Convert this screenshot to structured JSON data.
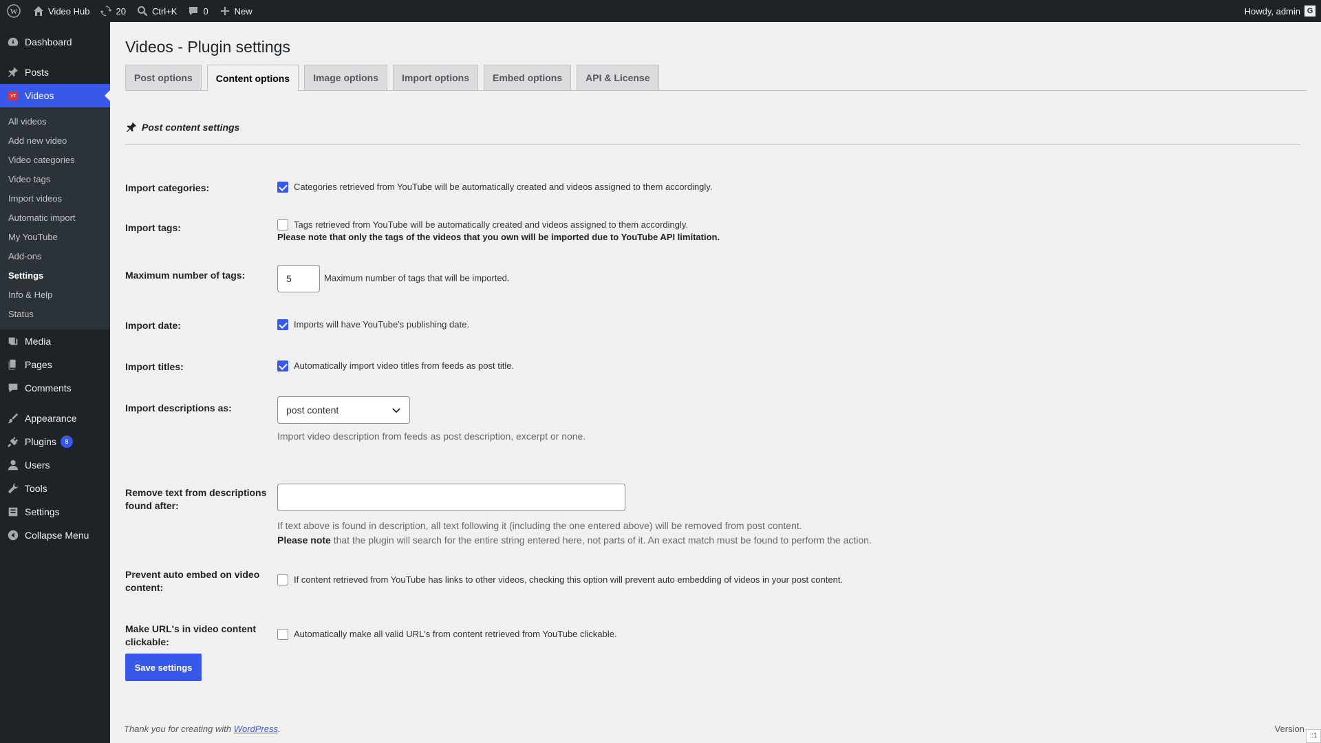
{
  "adminbar": {
    "site_name": "Video Hub",
    "updates_count": "20",
    "search_shortcut": "Ctrl+K",
    "comments_count": "0",
    "new_label": "New",
    "howdy": "Howdy, admin",
    "avatar_letter": "G"
  },
  "sidebar": {
    "dashboard": "Dashboard",
    "posts": "Posts",
    "videos": "Videos",
    "sub": [
      "All videos",
      "Add new video",
      "Video categories",
      "Video tags",
      "Import videos",
      "Automatic import",
      "My YouTube",
      "Add-ons",
      "Settings",
      "Info & Help",
      "Status"
    ],
    "media": "Media",
    "pages": "Pages",
    "comments": "Comments",
    "appearance": "Appearance",
    "plugins": "Plugins",
    "plugins_badge": "8",
    "users": "Users",
    "tools": "Tools",
    "settings": "Settings",
    "collapse": "Collapse Menu"
  },
  "page": {
    "title": "Videos - Plugin settings",
    "tabs": [
      "Post options",
      "Content options",
      "Image options",
      "Import options",
      "Embed options",
      "API & License"
    ],
    "section_title": "Post content settings"
  },
  "form": {
    "import_categories": {
      "label": "Import categories:",
      "desc": "Categories retrieved from YouTube will be automatically created and videos assigned to them accordingly.",
      "checked": true
    },
    "import_tags": {
      "label": "Import tags:",
      "desc": "Tags retrieved from YouTube will be automatically created and videos assigned to them accordingly.",
      "note": "Please note that only the tags of the videos that you own will be imported due to YouTube API limitation.",
      "checked": false
    },
    "max_tags": {
      "label": "Maximum number of tags:",
      "value": "5",
      "desc": "Maximum number of tags that will be imported."
    },
    "import_date": {
      "label": "Import date:",
      "desc": "Imports will have YouTube's publishing date.",
      "checked": true
    },
    "import_titles": {
      "label": "Import titles:",
      "desc": "Automatically import video titles from feeds as post title.",
      "checked": true
    },
    "import_descriptions": {
      "label": "Import descriptions as:",
      "selected": "post content",
      "desc": "Import video description from feeds as post description, excerpt or none."
    },
    "remove_text": {
      "label_line1": "Remove text from descriptions",
      "label_line2": "found after:",
      "value": "",
      "desc1": "If text above is found in description, all text following it (including the one entered above) will be removed from post content.",
      "desc2_bold": "Please note",
      "desc2_rest": " that the plugin will search for the entire string entered here, not parts of it. An exact match must be found to perform the action."
    },
    "prevent_embed": {
      "label_line1": "Prevent auto embed on video",
      "label_line2": "content:",
      "desc": "If content retrieved from YouTube has links to other videos, checking this option will prevent auto embedding of videos in your post content.",
      "checked": false
    },
    "make_urls": {
      "label_line1": "Make URL's in video content",
      "label_line2": "clickable:",
      "desc": "Automatically make all valid URL's from content retrieved from YouTube clickable.",
      "checked": false
    },
    "save_label": "Save settings"
  },
  "footer": {
    "thanks_prefix": "Thank you for creating with ",
    "link": "WordPress",
    "thanks_suffix": ".",
    "version": "Version",
    "corner": "::1"
  },
  "colors": {
    "accent": "#3858e9",
    "sidebar_bg": "#1d2327",
    "page_bg": "#f0f0f1"
  }
}
